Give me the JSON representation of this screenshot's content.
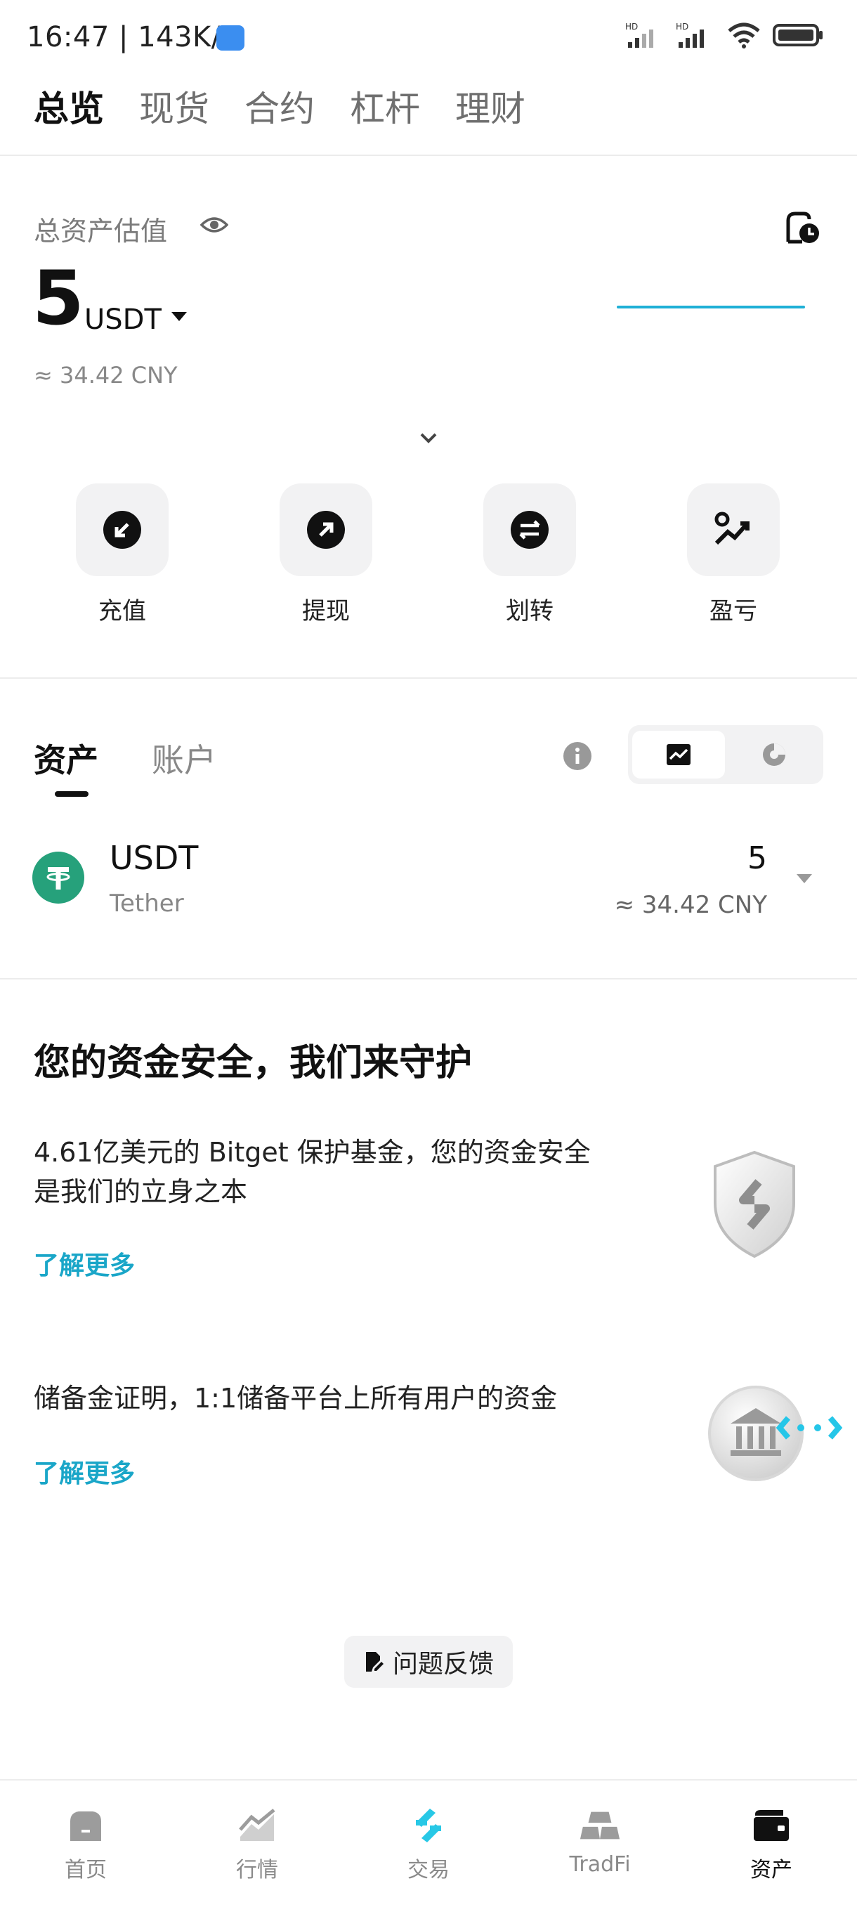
{
  "status_bar": {
    "time": "16:47",
    "speed": "143K/s"
  },
  "top_tabs": [
    "总览",
    "现货",
    "合约",
    "杠杆",
    "理财"
  ],
  "overview": {
    "label": "总资产估值",
    "amount": "5",
    "unit": "USDT",
    "cny": "≈ 34.42 CNY"
  },
  "actions": [
    {
      "label": "充值",
      "icon": "deposit-icon"
    },
    {
      "label": "提现",
      "icon": "withdraw-icon"
    },
    {
      "label": "划转",
      "icon": "transfer-icon"
    },
    {
      "label": "盈亏",
      "icon": "pnl-icon"
    }
  ],
  "asset_tabs": [
    "资产",
    "账户"
  ],
  "asset_row": {
    "symbol": "USDT",
    "name": "Tether",
    "amount": "5",
    "cny": "≈ 34.42 CNY"
  },
  "promo": {
    "title": "您的资金安全，我们来守护",
    "item1_text": "4.61亿美元的 Bitget 保护基金，您的资金安全是我们的立身之本",
    "item1_link": "了解更多",
    "item2_text": "储备金证明，1:1储备平台上所有用户的资金",
    "item2_link": "了解更多"
  },
  "feedback_label": "问题反馈",
  "bottom_nav": [
    {
      "label": "首页",
      "icon": "home-icon"
    },
    {
      "label": "行情",
      "icon": "market-icon"
    },
    {
      "label": "交易",
      "icon": "trade-icon"
    },
    {
      "label": "TradFi",
      "icon": "tradfi-icon"
    },
    {
      "label": "资产",
      "icon": "wallet-icon"
    }
  ],
  "colors": {
    "accent": "#1aa6c8",
    "tether": "#26a17b"
  }
}
